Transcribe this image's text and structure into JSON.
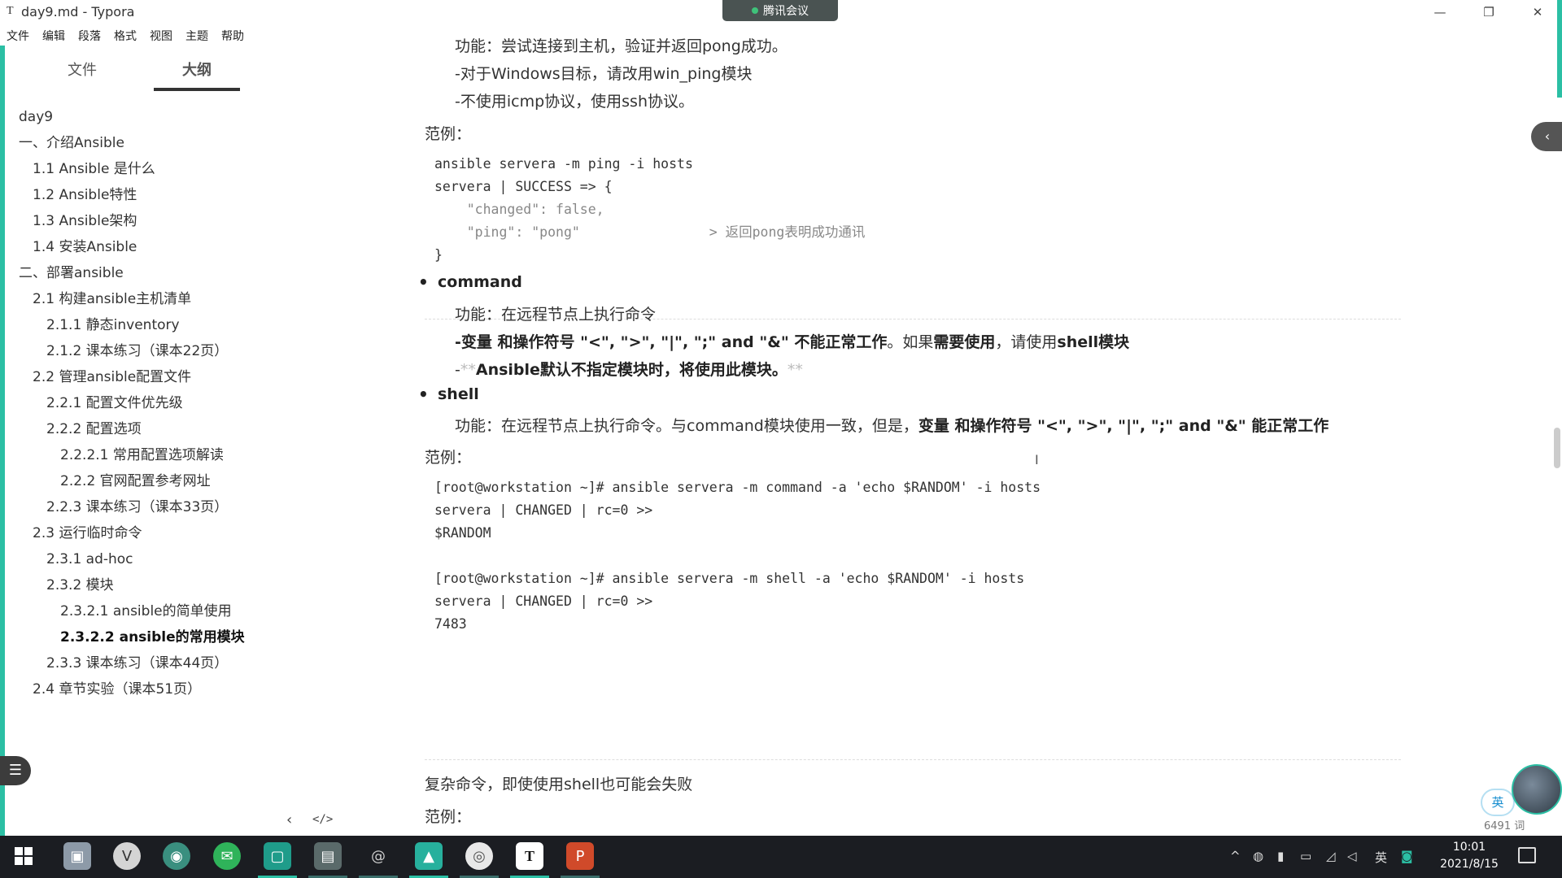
{
  "window": {
    "app_icon": "T",
    "title": "day9.md - Typora",
    "controls": [
      "—",
      "❐",
      "✕"
    ]
  },
  "meeting": {
    "label": "腾讯会议"
  },
  "menu": [
    "文件",
    "编辑",
    "段落",
    "格式",
    "视图",
    "主题",
    "帮助"
  ],
  "sidebar": {
    "tabs": {
      "files": "文件",
      "outline": "大纲"
    },
    "outline": [
      {
        "label": "day9",
        "level": 1
      },
      {
        "label": "一、介绍Ansible",
        "level": 1
      },
      {
        "label": "1.1 Ansible 是什么",
        "level": 2
      },
      {
        "label": "1.2 Ansible特性",
        "level": 2
      },
      {
        "label": "1.3 Ansible架构",
        "level": 2
      },
      {
        "label": "1.4 安装Ansible",
        "level": 2
      },
      {
        "label": "二、部署ansible",
        "level": 1
      },
      {
        "label": "2.1 构建ansible主机清单",
        "level": 2
      },
      {
        "label": "2.1.1 静态inventory",
        "level": 3
      },
      {
        "label": "2.1.2 课本练习（课本22页）",
        "level": 3
      },
      {
        "label": "2.2 管理ansible配置文件",
        "level": 2
      },
      {
        "label": "2.2.1 配置文件优先级",
        "level": 3
      },
      {
        "label": "2.2.2 配置选项",
        "level": 3
      },
      {
        "label": "2.2.2.1 常用配置选项解读",
        "level": 4
      },
      {
        "label": "2.2.2 官网配置参考网址",
        "level": 4
      },
      {
        "label": "2.2.3 课本练习（课本33页）",
        "level": 3
      },
      {
        "label": "2.3 运行临时命令",
        "level": 2
      },
      {
        "label": "2.3.1 ad-hoc",
        "level": 3
      },
      {
        "label": "2.3.2 模块",
        "level": 3
      },
      {
        "label": "2.3.2.1 ansible的简单使用",
        "level": 4
      },
      {
        "label": "2.3.2.2 ansible的常用模块",
        "level": 4,
        "active": true
      },
      {
        "label": "2.3.3 课本练习（课本44页）",
        "level": 3
      },
      {
        "label": "2.4 章节实验（课本51页）",
        "level": 2
      }
    ],
    "bottom": {
      "chevron": "‹",
      "code": "</>"
    }
  },
  "doc": {
    "p1": "功能：尝试连接到主机，验证并返回pong成功。",
    "p2": "-对于Windows目标，请改用win_ping模块",
    "p3": "-不使用icmp协议，使用ssh协议。",
    "example1": "范例：",
    "code1": [
      "ansible servera -m ping -i hosts",
      "servera | SUCCESS => {",
      "    \"changed\": false,",
      "    \"ping\": \"pong\"                > 返回pong表明成功通讯",
      "}"
    ],
    "bullet_command": "command",
    "cmd_func": "功能：在远程节点上执行命令",
    "cmd_note_bold": "-变量 和操作符号 \"<\", \">\", \"|\", \";\" and \"&\" 不能正常工作",
    "cmd_note_rest_a": "。如果",
    "cmd_note_bold2": "需要使用",
    "cmd_note_rest_b": "，请使用",
    "cmd_note_bold3": "shell模块",
    "cmd_default_prefix": "-",
    "cmd_default_stars": "**",
    "cmd_default": "Ansible默认不指定模块时，将使用此模块。",
    "bullet_shell": "shell",
    "shell_func": "功能：在远程节点上执行命令。与command模块使用一致，但是，",
    "shell_func_bold": "变量 和操作符号 \"<\", \">\", \"|\", \";\" and \"&\" 能正常工作",
    "example2": "范例：",
    "code2": [
      "[root@workstation ~]# ansible servera -m command -a 'echo $RANDOM' -i hosts",
      "servera | CHANGED | rc=0 >>",
      "$RANDOM",
      "",
      "[root@workstation ~]# ansible servera -m shell -a 'echo $RANDOM' -i hosts",
      "servera | CHANGED | rc=0 >>",
      "7483"
    ],
    "complex": "复杂命令，即使使用shell也可能会失败",
    "example3": "范例："
  },
  "status": {
    "ime": "英",
    "word_count": "6491 词"
  },
  "taskbar": {
    "apps": [
      "file-explorer-icon",
      "vivaldi-icon",
      "browser-icon",
      "wechat-icon",
      "remote-icon",
      "folder-icon",
      "snail-icon",
      "meeting-icon",
      "chrome-icon",
      "typora-icon",
      "powerpoint-icon"
    ],
    "tray_lang": "英",
    "time": "10:01",
    "date": "2021/8/15"
  }
}
